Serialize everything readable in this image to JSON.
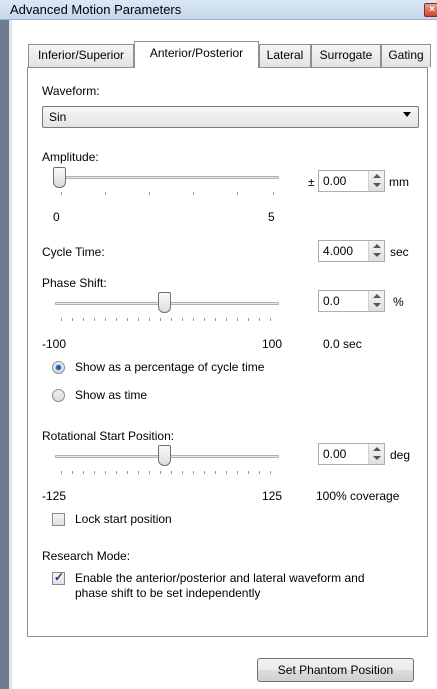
{
  "window": {
    "title": "Advanced Motion Parameters"
  },
  "tabs": [
    {
      "label": "Inferior/Superior"
    },
    {
      "label": "Anterior/Posterior",
      "active": true
    },
    {
      "label": "Lateral"
    },
    {
      "label": "Surrogate"
    },
    {
      "label": "Gating"
    }
  ],
  "waveform": {
    "label": "Waveform:",
    "value": "Sin"
  },
  "amplitude": {
    "label": "Amplitude:",
    "prefix": "±",
    "value": "0.00",
    "unit": "mm",
    "min_label": "0",
    "max_label": "5",
    "slider_fraction": 0.0
  },
  "cycle_time": {
    "label": "Cycle Time:",
    "value": "4.000",
    "unit": "sec"
  },
  "phase_shift": {
    "label": "Phase Shift:",
    "value": "0.0",
    "unit": "%",
    "min_label": "-100",
    "max_label": "100",
    "readout": "0.0 sec",
    "slider_fraction": 0.5,
    "options": [
      {
        "label": "Show as a percentage of cycle time",
        "selected": true
      },
      {
        "label": "Show as time",
        "selected": false
      }
    ]
  },
  "rotational_start": {
    "label": "Rotational Start Position:",
    "value": "0.00",
    "unit": "deg",
    "min_label": "-125",
    "max_label": "125",
    "readout": "100% coverage",
    "slider_fraction": 0.5,
    "lock_label": "Lock start position",
    "lock_checked": false
  },
  "research_mode": {
    "label": "Research Mode:",
    "checkbox_line1": "Enable the anterior/posterior and lateral waveform and",
    "checkbox_line2": "phase shift to be set independently",
    "checked": true
  },
  "buttons": {
    "set_phantom_position": "Set Phantom Position"
  }
}
